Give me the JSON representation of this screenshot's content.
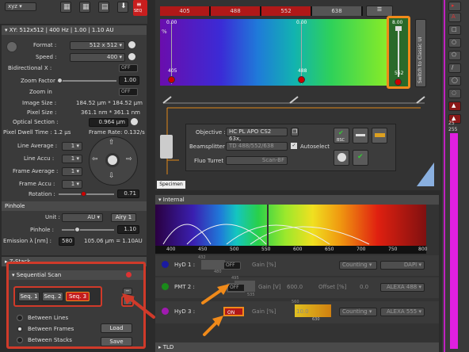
{
  "toolbar": {
    "mode_value": "xyz",
    "seq_badge": "SEQ"
  },
  "xy_panel": {
    "header": "XY: 512x512 | 400 Hz | 1.00 | 1.10 AU",
    "format_label": "Format :",
    "format_value": "512 x 512",
    "speed_label": "Speed :",
    "speed_value": "400",
    "bidirectional_label": "Bidirectional X :",
    "bidirectional_state": "OFF",
    "zoom_factor_label": "Zoom Factor :",
    "zoom_factor_value": "1.00",
    "zoom_in_label": "Zoom in",
    "zoom_in_state": "OFF",
    "image_size_label": "Image Size :",
    "image_size_value": "184.52 µm * 184.52 µm",
    "pixel_size_label": "Pixel Size :",
    "pixel_size_value": "361.1 nm * 361.1 nm",
    "optical_section_label": "Optical Section :",
    "optical_section_value": "0.964 µm",
    "pixel_dwell_label": "Pixel Dwell Time : 1.2 µs",
    "frame_rate_label": "Frame Rate: 0.132/s",
    "line_average_label": "Line Average :",
    "line_average_value": "1",
    "line_accu_label": "Line Accu :",
    "line_accu_value": "1",
    "frame_average_label": "Frame Average :",
    "frame_average_value": "1",
    "frame_accu_label": "Frame Accu :",
    "frame_accu_value": "1",
    "rotation_label": "Rotation :",
    "rotation_value": "0.71",
    "pinhole_header": "Pinhole",
    "unit_label": "Unit :",
    "unit_value": "AU",
    "airy_button": "Airy 1",
    "pinhole_label": "Pinhole :",
    "pinhole_value": "1.10",
    "emission_label": "Emission λ [nm] :",
    "emission_value": "580",
    "pinhole_readout": "105.06 µm = 1.10AU"
  },
  "zstack_header": "Z-Stack",
  "seq_panel": {
    "header": "Sequential Scan",
    "seq1": "Seq. 1",
    "seq2": "Seq. 2",
    "seq3": "Seq. 3",
    "between_lines": "Between Lines",
    "between_frames": "Between Frames",
    "between_stacks": "Between Stacks",
    "load": "Load",
    "save": "Save"
  },
  "lasers": {
    "tabs": [
      "405",
      "488",
      "552",
      "638"
    ],
    "percent": "%",
    "channels": [
      {
        "value": "0.00",
        "name": "405"
      },
      {
        "value": "0.00",
        "name": "488"
      },
      {
        "value": "8.00",
        "name": "552"
      }
    ],
    "classic_ui": "Switch to Classic UI"
  },
  "beam_path": {
    "objective_label": "Objective :",
    "objective_value": "HC PL APO CS2  63x,",
    "beamsplitter_label": "Beamsplitter :",
    "beamsplitter_value": "TD 488/552/638",
    "autoselect_label": "Autoselect",
    "fluo_turret_label": "Fluo Turret :",
    "fluo_turret_value": "Scan-BF",
    "bsc_label": "BSC",
    "specimen_label": "Specimen"
  },
  "internal": {
    "header": "Internal",
    "axis_ticks": [
      "400",
      "450",
      "500",
      "550",
      "600",
      "650",
      "700",
      "750",
      "800"
    ],
    "detectors": [
      {
        "name": "HyD 1 :",
        "state": "OFF",
        "gain_label": "Gain [%]",
        "mode": "Counting",
        "dye": "DAPI",
        "range_top": "432",
        "range_bot": "480"
      },
      {
        "name": "PMT 2 :",
        "state": "OFF",
        "gain_label": "Gain [V]",
        "gain_value": "600.0",
        "offset_label": "Offset [%]",
        "offset_value": "0.0",
        "dye": "ALEXA 488",
        "range_top": "495",
        "range_bot": "535"
      },
      {
        "name": "HyD 3 :",
        "state": "ON",
        "gain_label": "Gain [%]",
        "gain_value": "10.0",
        "mode": "Counting",
        "dye": "ALEXA 555",
        "range_top": "560",
        "range_bot": "630"
      }
    ],
    "tld_header": "TLD"
  },
  "right_strip": {
    "value_top": "25",
    "value_bottom": "255"
  }
}
